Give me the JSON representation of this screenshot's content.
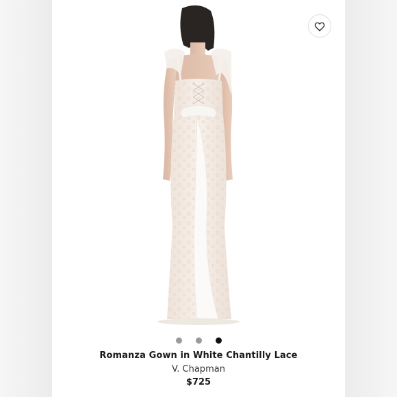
{
  "product": {
    "name": "Romanza Gown in White Chantilly Lace",
    "brand": "V. Chapman",
    "price": "$725"
  },
  "gallery": {
    "image_count": 3,
    "active_index": 2
  },
  "icons": {
    "favorite": "heart-icon"
  },
  "colors": {
    "active_dot": "#111111",
    "inactive_dot": "#9a9a9a"
  }
}
